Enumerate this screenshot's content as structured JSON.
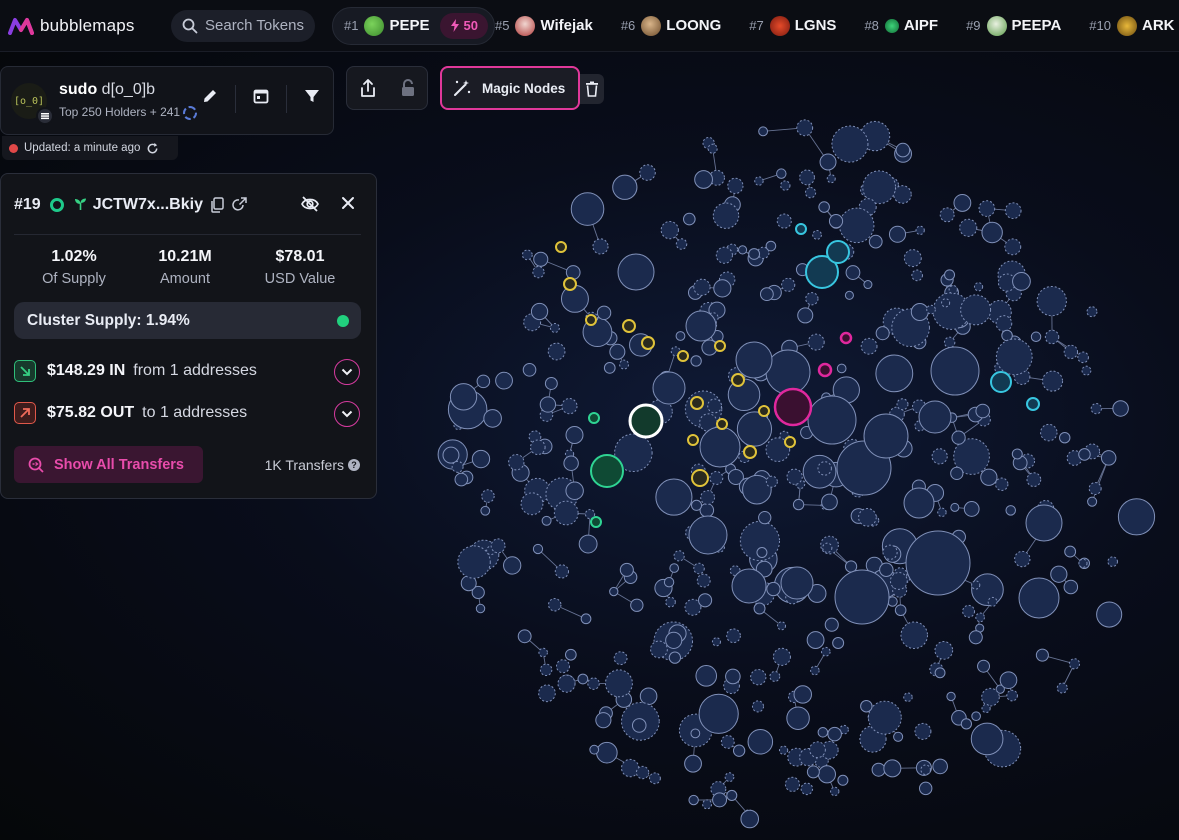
{
  "app": {
    "name": "bubblemaps"
  },
  "search": {
    "placeholder": "Search Tokens"
  },
  "trending": [
    {
      "rank": "#1",
      "name": "PEPE",
      "icon": "frog-icon",
      "boost": "50"
    },
    {
      "rank": "#5",
      "name": "Wifejak",
      "icon": "avatar-icon"
    },
    {
      "rank": "#6",
      "name": "LOONG",
      "icon": "dragon-icon"
    },
    {
      "rank": "#7",
      "name": "LGNS",
      "icon": "lgns-icon"
    },
    {
      "rank": "#8",
      "name": "AIPF",
      "icon": "aipf-icon"
    },
    {
      "rank": "#9",
      "name": "PEEPA",
      "icon": "frog-icon"
    },
    {
      "rank": "#10",
      "name": "ARK",
      "icon": "ark-icon"
    }
  ],
  "token": {
    "avatar_text": "[o_0]",
    "name": "sudo",
    "symbol": "d[o_0]b",
    "subtitle": "Top 250 Holders + 241",
    "updated": "Updated: a minute ago"
  },
  "toolbar": {
    "magic_label": "Magic Nodes"
  },
  "wallet": {
    "rank": "#19",
    "address": "JCTW7x...Bkiy",
    "stats": [
      {
        "value": "1.02%",
        "label": "Of Supply"
      },
      {
        "value": "10.21M",
        "label": "Amount"
      },
      {
        "value": "$78.01",
        "label": "USD Value"
      }
    ],
    "cluster_supply": "Cluster Supply: 1.94%",
    "in_amount": "$148.29 IN",
    "in_text": "from 1 addresses",
    "out_amount": "$75.82 OUT",
    "out_text": "to 1 addresses",
    "show_transfers": "Show All Transfers",
    "transfers_count": "1K Transfers"
  },
  "colors": {
    "accent": "#e0389a",
    "bubble_default": "#1b2a4d",
    "bubble_yellow": "#e0c33a",
    "bubble_cyan": "#38c6e0",
    "bubble_green": "#2fd493",
    "bubble_magenta": "#e0289e"
  }
}
